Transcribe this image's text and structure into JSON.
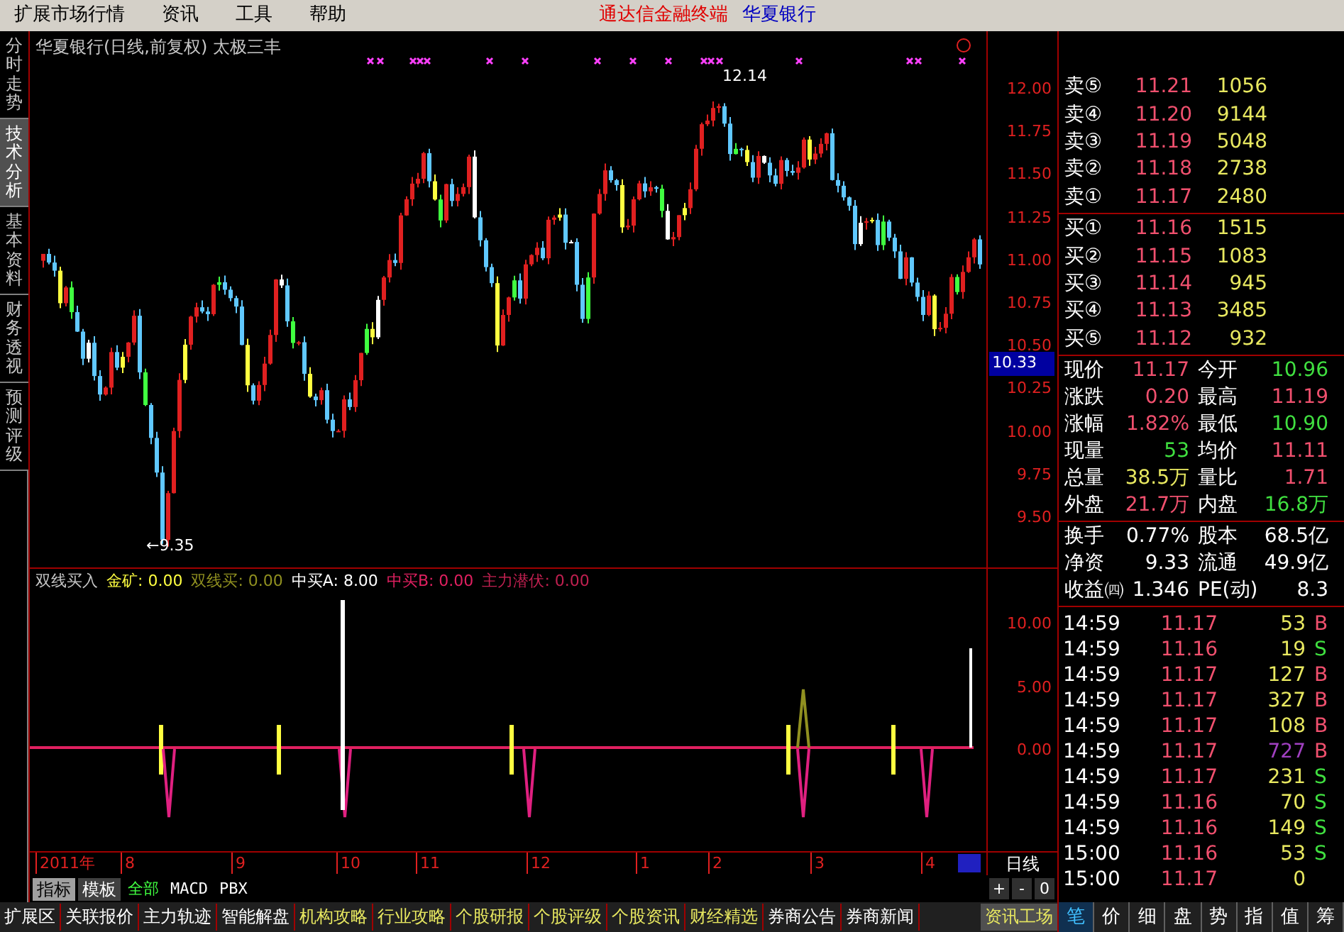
{
  "menu_bar": {
    "items": [
      "扩展市场行情",
      "资讯",
      "工具",
      "帮助"
    ],
    "app_title": "通达信金融终端",
    "stock_name": "华夏银行"
  },
  "side_tabs": [
    {
      "label": "分时走势",
      "selected": false
    },
    {
      "label": "技术分析",
      "selected": true
    },
    {
      "label": "基本资料",
      "selected": false
    },
    {
      "label": "财务透视",
      "selected": false
    },
    {
      "label": "预测评级",
      "selected": false
    }
  ],
  "main_chart": {
    "title": "华夏银行(日线,前复权) 太极三丰",
    "high_label": "12.14",
    "low_label": "←9.35",
    "y_ticks": [
      "12.00",
      "11.75",
      "11.50",
      "11.25",
      "11.00",
      "10.75",
      "10.50",
      "10.25",
      "10.00",
      "9.75",
      "9.50"
    ],
    "price_tag": "10.33"
  },
  "indicator": {
    "legend": [
      {
        "text": "双线买入",
        "color": "#c8c8c8"
      },
      {
        "text": "金矿: 0.00",
        "color": "#ffff40"
      },
      {
        "text": "双线买: 0.00",
        "color": "#909020"
      },
      {
        "text": "中买A: 8.00",
        "color": "#ffffff"
      },
      {
        "text": "中买B: 0.00",
        "color": "#e02060"
      },
      {
        "text": "主力潜伏: 0.00",
        "color": "#c02050"
      }
    ],
    "y_ticks": [
      "10.00",
      "5.00",
      "0.00"
    ]
  },
  "date_axis": {
    "labels": [
      "2011年",
      "8",
      "9",
      "10",
      "11",
      "12",
      "1",
      "2",
      "3",
      "4"
    ],
    "period": "日线"
  },
  "view_tabs": [
    {
      "label": "指标",
      "selected": true
    },
    {
      "label": "模板",
      "selected": false
    }
  ],
  "filter_tabs": [
    {
      "label": "全部",
      "selected": true
    },
    {
      "label": "MACD",
      "selected": false
    },
    {
      "label": "PBX",
      "selected": false
    }
  ],
  "zoom_buttons": [
    "+",
    "-",
    "0"
  ],
  "bottom_tabs": [
    {
      "label": "扩展区",
      "color": "#ffffff"
    },
    {
      "label": "关联报价",
      "color": "#ffffff"
    },
    {
      "label": "主力轨迹",
      "color": "#ffffff"
    },
    {
      "label": "智能解盘",
      "color": "#ffffff"
    },
    {
      "label": "机构攻略",
      "color": "#e8e860"
    },
    {
      "label": "行业攻略",
      "color": "#e8e860"
    },
    {
      "label": "个股研报",
      "color": "#e8e860"
    },
    {
      "label": "个股评级",
      "color": "#e8e860"
    },
    {
      "label": "个股资讯",
      "color": "#e8e860"
    },
    {
      "label": "财经精选",
      "color": "#e8e860"
    },
    {
      "label": "券商公告",
      "color": "#ffffff"
    },
    {
      "label": "券商新闻",
      "color": "#ffffff"
    }
  ],
  "info_button": "资讯工场",
  "order_book": {
    "asks": [
      {
        "label": "卖⑤",
        "price": "11.21",
        "volume": "1056"
      },
      {
        "label": "卖④",
        "price": "11.20",
        "volume": "9144"
      },
      {
        "label": "卖③",
        "price": "11.19",
        "volume": "5048"
      },
      {
        "label": "卖②",
        "price": "11.18",
        "volume": "2738"
      },
      {
        "label": "卖①",
        "price": "11.17",
        "volume": "2480"
      }
    ],
    "bids": [
      {
        "label": "买①",
        "price": "11.16",
        "volume": "1515"
      },
      {
        "label": "买②",
        "price": "11.15",
        "volume": "1083"
      },
      {
        "label": "买③",
        "price": "11.14",
        "volume": "945"
      },
      {
        "label": "买④",
        "price": "11.13",
        "volume": "3485"
      },
      {
        "label": "买⑤",
        "price": "11.12",
        "volume": "932"
      }
    ]
  },
  "quotes": [
    {
      "label": "现价",
      "value": "11.17",
      "color": "#f0506e"
    },
    {
      "label": "今开",
      "value": "10.96",
      "color": "#40e040"
    },
    {
      "label": "涨跌",
      "value": "0.20",
      "color": "#f0506e"
    },
    {
      "label": "最高",
      "value": "11.19",
      "color": "#f0506e"
    },
    {
      "label": "涨幅",
      "value": "1.82%",
      "color": "#f0506e"
    },
    {
      "label": "最低",
      "value": "10.90",
      "color": "#40e040"
    },
    {
      "label": "现量",
      "value": "53",
      "color": "#40e040"
    },
    {
      "label": "均价",
      "value": "11.11",
      "color": "#f0506e"
    },
    {
      "label": "总量",
      "value": "38.5万",
      "color": "#e8e860"
    },
    {
      "label": "量比",
      "value": "1.71",
      "color": "#f0506e"
    },
    {
      "label": "外盘",
      "value": "21.7万",
      "color": "#f0506e"
    },
    {
      "label": "内盘",
      "value": "16.8万",
      "color": "#40e040"
    }
  ],
  "stats": [
    {
      "label": "换手",
      "value": "0.77%"
    },
    {
      "label": "股本",
      "value": "68.5亿"
    },
    {
      "label": "净资",
      "value": "9.33"
    },
    {
      "label": "流通",
      "value": "49.9亿"
    },
    {
      "label": "收益㈣",
      "value": "1.346"
    },
    {
      "label": "PE(动)",
      "value": "8.3"
    }
  ],
  "ticks": [
    {
      "time": "14:59",
      "price": "11.17",
      "volume": "53",
      "color": "#e8e860",
      "side": "B",
      "kind": "buy"
    },
    {
      "time": "14:59",
      "price": "11.16",
      "volume": "19",
      "color": "#e8e860",
      "side": "S",
      "kind": "sell"
    },
    {
      "time": "14:59",
      "price": "11.17",
      "volume": "127",
      "color": "#e8e860",
      "side": "B",
      "kind": "buy"
    },
    {
      "time": "14:59",
      "price": "11.17",
      "volume": "327",
      "color": "#e8e860",
      "side": "B",
      "kind": "buy"
    },
    {
      "time": "14:59",
      "price": "11.17",
      "volume": "108",
      "color": "#e8e860",
      "side": "B",
      "kind": "buy"
    },
    {
      "time": "14:59",
      "price": "11.17",
      "volume": "727",
      "color": "#a040c0",
      "side": "B",
      "kind": "buy"
    },
    {
      "time": "14:59",
      "price": "11.17",
      "volume": "231",
      "color": "#e8e860",
      "side": "S",
      "kind": "sell"
    },
    {
      "time": "14:59",
      "price": "11.16",
      "volume": "70",
      "color": "#e8e860",
      "side": "S",
      "kind": "sell"
    },
    {
      "time": "14:59",
      "price": "11.16",
      "volume": "149",
      "color": "#e8e860",
      "side": "S",
      "kind": "sell"
    },
    {
      "time": "15:00",
      "price": "11.16",
      "volume": "53",
      "color": "#e8e860",
      "side": "S",
      "kind": "sell"
    },
    {
      "time": "15:00",
      "price": "11.17",
      "volume": "0",
      "color": "#e8e860",
      "kind": "none"
    }
  ],
  "panel_tabs": [
    {
      "label": "笔",
      "selected": true
    },
    {
      "label": "价",
      "selected": false
    },
    {
      "label": "细",
      "selected": false
    },
    {
      "label": "盘",
      "selected": false
    },
    {
      "label": "势",
      "selected": false
    },
    {
      "label": "指",
      "selected": false
    },
    {
      "label": "值",
      "selected": false
    },
    {
      "label": "筹",
      "selected": false
    }
  ]
}
